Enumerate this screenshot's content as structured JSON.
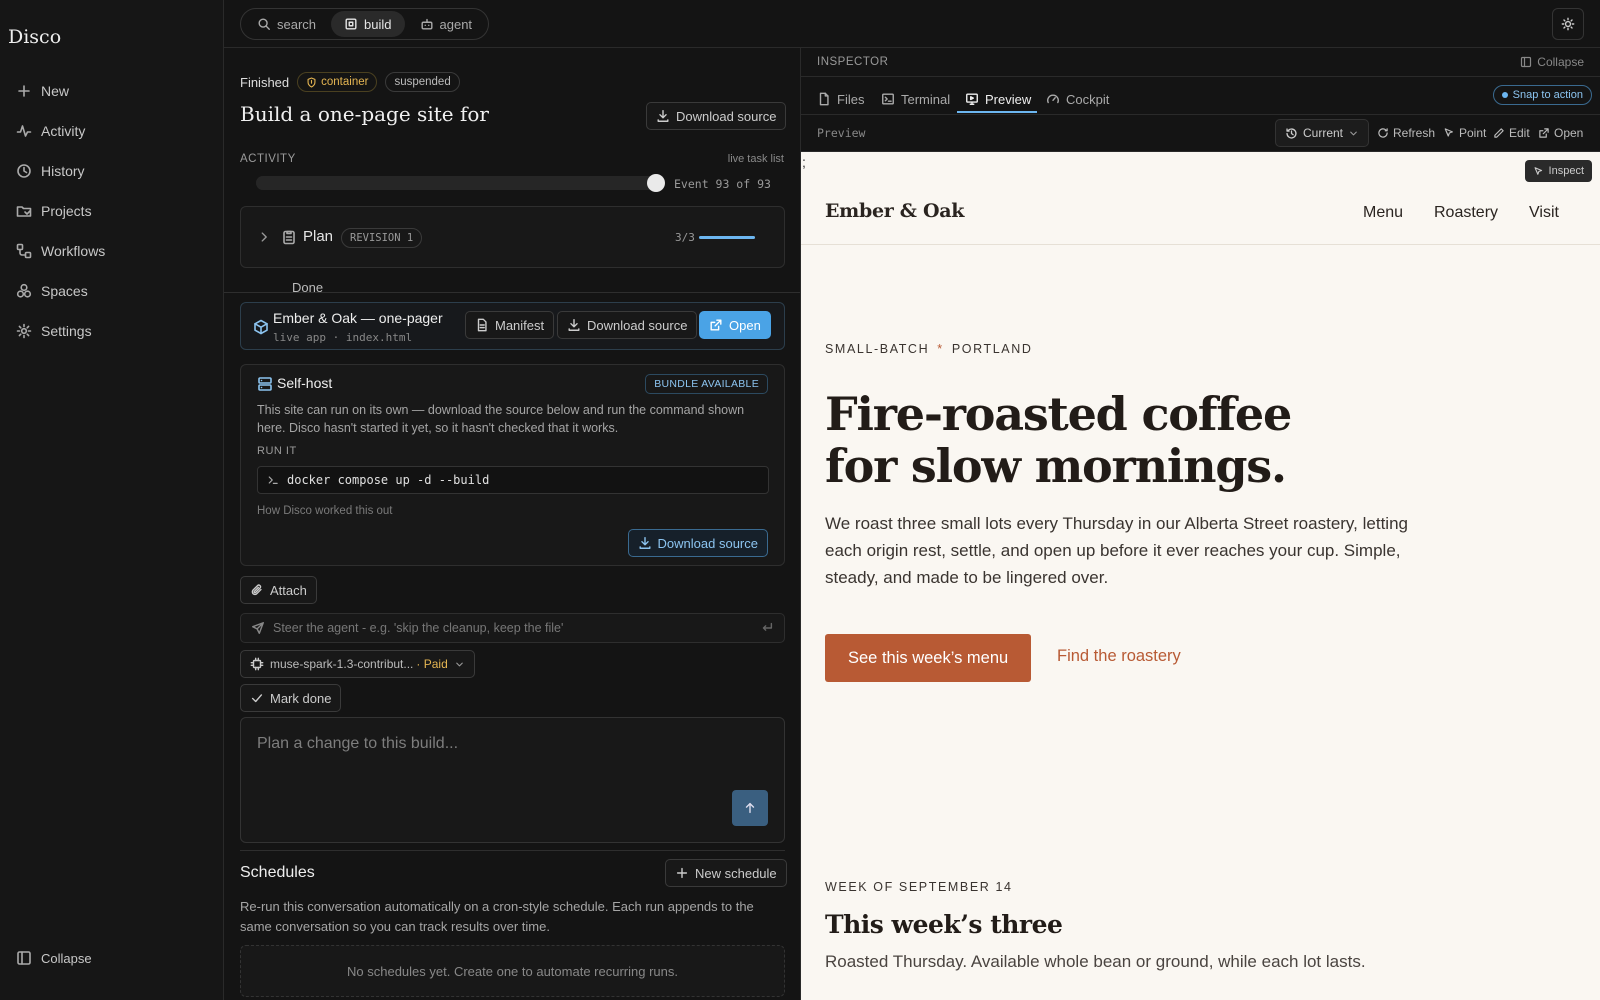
{
  "sidebar": {
    "brand": "Disco",
    "items": [
      {
        "label": "New",
        "icon": "plus-icon"
      },
      {
        "label": "Activity",
        "icon": "activity-icon"
      },
      {
        "label": "History",
        "icon": "clock-icon"
      },
      {
        "label": "Projects",
        "icon": "folder-icon"
      },
      {
        "label": "Workflows",
        "icon": "workflow-icon"
      },
      {
        "label": "Spaces",
        "icon": "spaces-icon"
      },
      {
        "label": "Settings",
        "icon": "gear-icon"
      }
    ],
    "collapse_label": "Collapse"
  },
  "topbar": {
    "modes": [
      {
        "label": "search",
        "icon": "search-icon"
      },
      {
        "label": "build",
        "icon": "build-icon"
      },
      {
        "label": "agent",
        "icon": "robot-icon"
      }
    ],
    "active_mode": "build"
  },
  "task": {
    "status": "Finished",
    "badge_container": "container",
    "badge_suspended": "suspended",
    "title": "Build a one-page site for",
    "download_label": "Download source"
  },
  "activity": {
    "heading": "ACTIVITY",
    "live_label": "live task list",
    "event_label": "Event 93 of 93",
    "progress": 1.0
  },
  "plan": {
    "label": "Plan",
    "revision": "REVISION 1",
    "count": "3/3",
    "progress": 1.0,
    "overflow_text": "Done"
  },
  "app": {
    "name": "Ember & Oak — one-pager",
    "sub": "live app · index.html",
    "manifest_label": "Manifest",
    "download_label": "Download source",
    "open_label": "Open"
  },
  "selfhost": {
    "title": "Self-host",
    "badge": "BUNDLE AVAILABLE",
    "description": "This site can run on its own — download the source below and run the command shown here. Disco hasn't started it yet, so it hasn't checked that it works.",
    "run_label": "RUN IT",
    "command": "docker compose up -d --build",
    "how_label": "How Disco worked this out",
    "download_label": "Download source"
  },
  "composer": {
    "attach_label": "Attach",
    "steer_placeholder": "Steer the agent - e.g. 'skip the cleanup, keep the file'",
    "model_label": "muse-spark-1.3-contribut...",
    "model_tier": "· Paid",
    "mark_done_label": "Mark done",
    "plan_placeholder": "Plan a change to this build..."
  },
  "schedules": {
    "title": "Schedules",
    "new_label": "New schedule",
    "description": "Re-run this conversation automatically on a cron-style schedule. Each run appends to the same conversation so you can track results over time.",
    "empty": "No schedules yet. Create one to automate recurring runs."
  },
  "inspector": {
    "title": "INSPECTOR",
    "collapse_label": "Collapse",
    "tabs": [
      {
        "label": "Files",
        "icon": "file-icon"
      },
      {
        "label": "Terminal",
        "icon": "terminal-icon"
      },
      {
        "label": "Preview",
        "icon": "preview-icon"
      },
      {
        "label": "Cockpit",
        "icon": "gauge-icon"
      }
    ],
    "active_tab": "Preview",
    "snap_label": "Snap to action",
    "preview_label": "Preview",
    "version_label": "Current",
    "tools": [
      "Refresh",
      "Point",
      "Edit",
      "Open"
    ],
    "inspect_label": "Inspect",
    "stray_glyph": ";"
  },
  "site": {
    "logo": "Ember & Oak",
    "nav": [
      "Menu",
      "Roastery",
      "Visit"
    ],
    "eyebrow_left": "SMALL-BATCH",
    "eyebrow_sep": "*",
    "eyebrow_right": "PORTLAND",
    "headline_1": "Fire-roasted coffee",
    "headline_2": "for slow mornings.",
    "body": "We roast three small lots every Thursday in our Alberta Street roastery, letting each origin rest, settle, and open up before it ever reaches your cup. Simple, steady, and made to be lingered over.",
    "cta_primary": "See this week’s menu",
    "cta_secondary": "Find the roastery",
    "week_label": "WEEK OF SEPTEMBER 14",
    "section_title": "This week’s three",
    "section_sub": "Roasted Thursday. Available whole bean or ground, while each lot lasts.",
    "accent": "#b85a34"
  }
}
